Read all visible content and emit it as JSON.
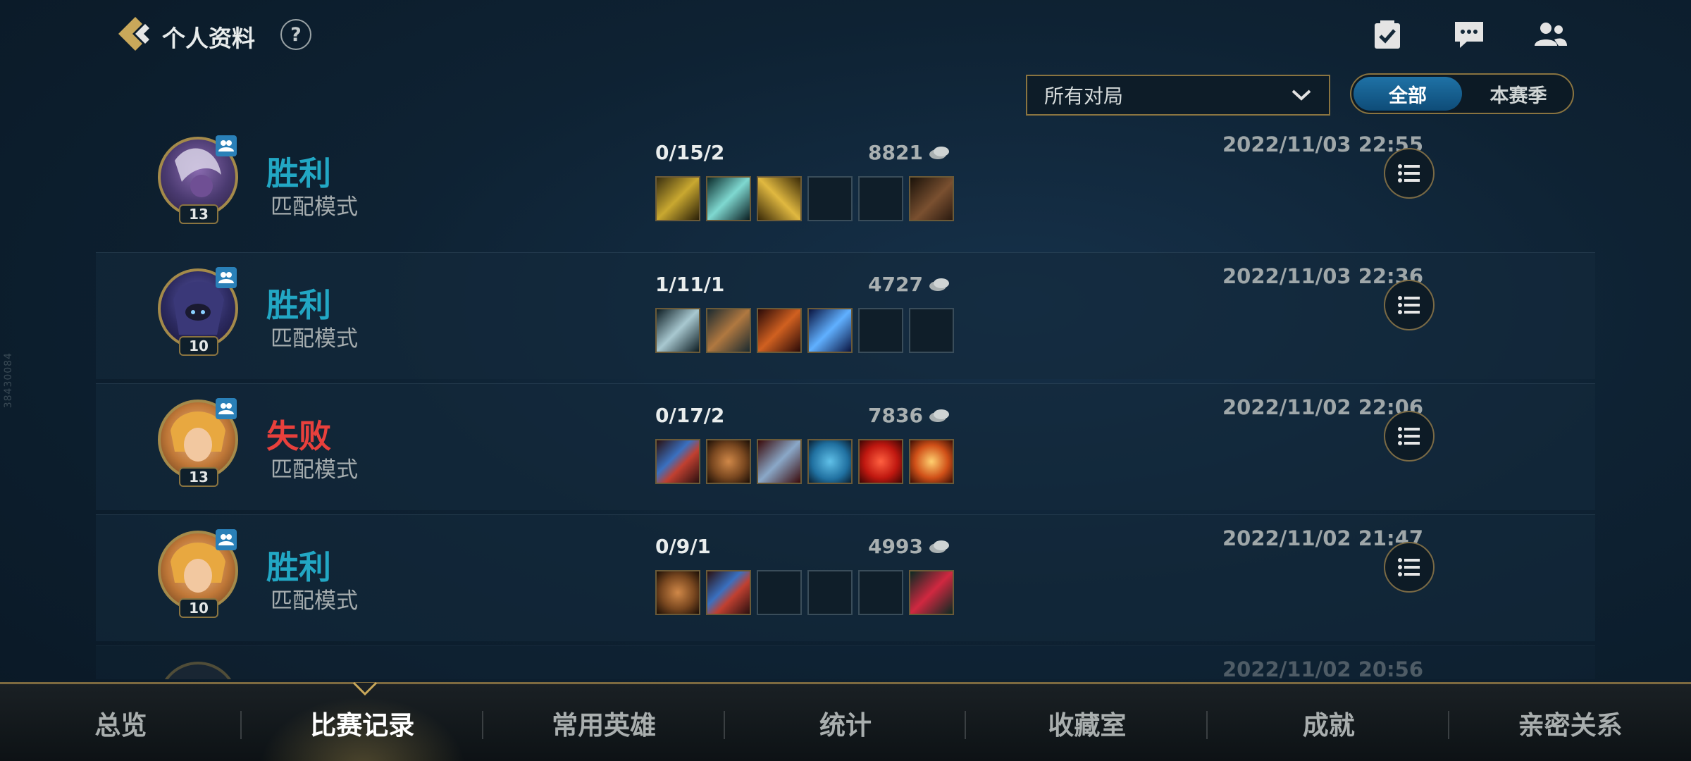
{
  "header": {
    "title": "个人资料",
    "help": "?"
  },
  "filter": {
    "selected": "所有对局"
  },
  "season_toggle": {
    "options": [
      "全部",
      "本赛季"
    ],
    "active_index": 0
  },
  "matches": [
    {
      "result": "胜利",
      "outcome": "win",
      "mode": "匹配模式",
      "level": "13",
      "kda": "0/15/2",
      "gold": "8821",
      "date": "2022/11/03 22:55",
      "items": [
        "golden-dagger",
        "jade-blade",
        "crossed-blades",
        "",
        "",
        "leather-boots"
      ]
    },
    {
      "result": "胜利",
      "outcome": "win",
      "mode": "匹配模式",
      "level": "10",
      "kda": "1/11/1",
      "gold": "4727",
      "date": "2022/11/03 22:36",
      "items": [
        "silver-sword",
        "shield-blade",
        "crimson-scythe",
        "azure-sword",
        "",
        ""
      ]
    },
    {
      "result": "失败",
      "outcome": "loss",
      "mode": "匹配模式",
      "level": "13",
      "kda": "0/17/2",
      "gold": "7836",
      "date": "2022/11/02 22:06",
      "items": [
        "guardian-armor",
        "bronze-shield",
        "steel-wings",
        "chain-vest",
        "red-potion",
        "sun-emblem"
      ]
    },
    {
      "result": "胜利",
      "outcome": "win",
      "mode": "匹配模式",
      "level": "10",
      "kda": "0/9/1",
      "gold": "4993",
      "date": "2022/11/02 21:47",
      "items": [
        "bronze-shield",
        "guardian-armor",
        "",
        "",
        "",
        "crimson-boots"
      ]
    },
    {
      "result": "",
      "outcome": "win",
      "mode": "",
      "level": "",
      "kda": "",
      "gold": "",
      "date": "2022/11/02 20:56",
      "items": []
    }
  ],
  "tabs": [
    "总览",
    "比赛记录",
    "常用英雄",
    "统计",
    "收藏室",
    "成就",
    "亲密关系"
  ],
  "active_tab_index": 1,
  "colors": {
    "win": "#22a7c4",
    "loss": "#e8403c",
    "gold_border": "#8a7440",
    "accent_blue": "#1f72a6"
  },
  "watermark": "38430084"
}
